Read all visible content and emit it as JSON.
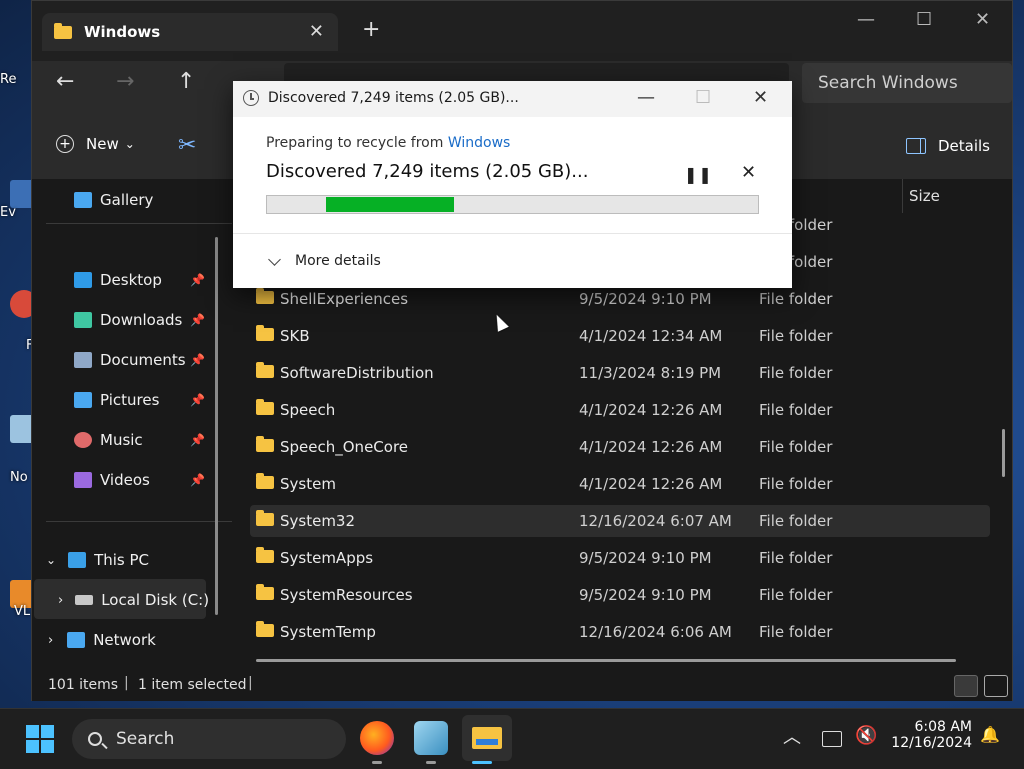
{
  "desktop": {
    "icon_labels": [
      "Re",
      "Ev",
      "F",
      "No",
      "VL"
    ]
  },
  "explorer": {
    "tab_title": "Windows",
    "tab_close": "✕",
    "tab_add": "+",
    "window_controls": {
      "minimize": "—",
      "maximize": "☐",
      "close": "✕"
    },
    "nav": {
      "back": "←",
      "forward": "→",
      "up": "↑"
    },
    "search_placeholder": "Search Windows",
    "toolbar": {
      "new_label": "New",
      "new_chevron": "⌄",
      "cut_icon": "✂",
      "details_label": "Details"
    },
    "sidebar": {
      "gallery": "Gallery",
      "quick_access": [
        {
          "label": "Desktop",
          "icon": "desktop-icon",
          "color": "#2f9be8"
        },
        {
          "label": "Downloads",
          "icon": "download-icon",
          "color": "#3fc7a2"
        },
        {
          "label": "Documents",
          "icon": "document-icon",
          "color": "#8fa8c8"
        },
        {
          "label": "Pictures",
          "icon": "picture-icon",
          "color": "#4aa8f0"
        },
        {
          "label": "Music",
          "icon": "music-icon",
          "color": "#e06a6a"
        },
        {
          "label": "Videos",
          "icon": "video-icon",
          "color": "#9b6ae0"
        }
      ],
      "pin": "📌",
      "this_pc": "This PC",
      "local_disk": "Local Disk (C:)",
      "network": "Network"
    },
    "columns": {
      "size": "Size"
    },
    "rows": [
      {
        "name": "ShellExperiences",
        "date": "9/5/2024 9:10 PM",
        "type": "File folder"
      },
      {
        "name": "SKB",
        "date": "4/1/2024 12:34 AM",
        "type": "File folder"
      },
      {
        "name": "SoftwareDistribution",
        "date": "11/3/2024 8:19 PM",
        "type": "File folder"
      },
      {
        "name": "Speech",
        "date": "4/1/2024 12:26 AM",
        "type": "File folder"
      },
      {
        "name": "Speech_OneCore",
        "date": "4/1/2024 12:26 AM",
        "type": "File folder"
      },
      {
        "name": "System",
        "date": "4/1/2024 12:26 AM",
        "type": "File folder"
      },
      {
        "name": "System32",
        "date": "12/16/2024 6:07 AM",
        "type": "File folder",
        "selected": true
      },
      {
        "name": "SystemApps",
        "date": "9/5/2024 9:10 PM",
        "type": "File folder"
      },
      {
        "name": "SystemResources",
        "date": "9/5/2024 9:10 PM",
        "type": "File folder"
      },
      {
        "name": "SystemTemp",
        "date": "12/16/2024 6:06 AM",
        "type": "File folder"
      }
    ],
    "hidden_row_types": [
      "folder",
      "folder"
    ],
    "status": {
      "count": "101 items",
      "selected": "1 item selected",
      "sep": "|"
    }
  },
  "dialog": {
    "title": "Discovered 7,249 items (2.05 GB)...",
    "prep_prefix": "Preparing to recycle from ",
    "prep_link": "Windows",
    "main_text": "Discovered 7,249 items (2.05 GB)...",
    "pause_icon": "❚❚",
    "cancel_icon": "✕",
    "progress": {
      "start": 0.12,
      "end": 0.38
    },
    "more_details": "More details",
    "controls": {
      "minimize": "—",
      "maximize": "☐",
      "close": "✕"
    }
  },
  "taskbar": {
    "search_label": "Search",
    "time": "6:08 AM",
    "date": "12/16/2024",
    "tray": {
      "chevron": "︿",
      "notification": "🔔"
    }
  },
  "colors": {
    "accent": "#4cc2ff",
    "progress": "#06b025",
    "folder": "#f6c342"
  }
}
